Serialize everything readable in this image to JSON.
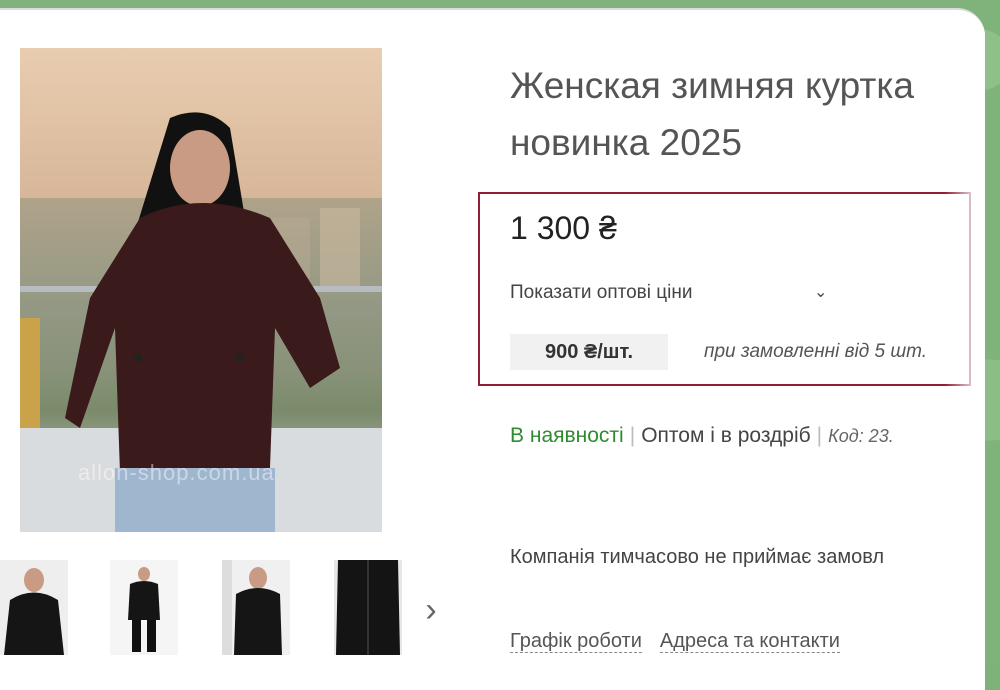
{
  "product": {
    "title": "Женская зимняя куртка новинка 2025",
    "price": "1 300 ₴",
    "wholesale_toggle_label": "Показати оптові ціни",
    "wholesale_price": "900 ₴/шт.",
    "wholesale_note": "при замовленні від 5 шт."
  },
  "status": {
    "availability": "В наявності",
    "sale_type": "Оптом і в роздріб",
    "code": "Код: 23."
  },
  "notice": "Компанія тимчасово не приймає замовл",
  "links": {
    "schedule": "Графік роботи",
    "address": "Адреса та контакти"
  },
  "gallery": {
    "watermark": "allon-shop.com.ua"
  },
  "colors": {
    "in_stock": "#2e8b2e",
    "price_box_border": "#8e1f39",
    "background": "#80b37b",
    "jacket": "#3a1a1a"
  }
}
